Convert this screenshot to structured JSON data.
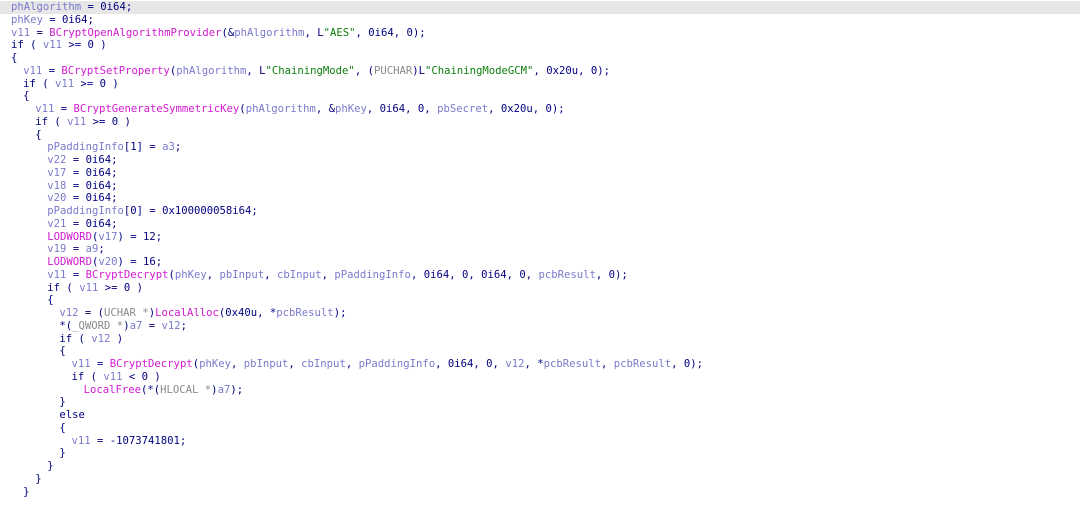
{
  "colors": {
    "highlight": "#e6e6e6",
    "variable": "#1f1fa8",
    "argument": "#7a7acc",
    "function": "#d21bd2",
    "string": "#0e7e0e",
    "type": "#8a8a8a",
    "default": "#000080"
  },
  "lines": [
    {
      "highlight": true,
      "indent": 0,
      "tokens": [
        {
          "t": "phAlgorithm",
          "k": "arg"
        },
        {
          "t": " = 0i64;",
          "k": "punc"
        }
      ]
    },
    {
      "indent": 0,
      "tokens": [
        {
          "t": "phKey",
          "k": "arg"
        },
        {
          "t": " = 0i64;",
          "k": "punc"
        }
      ]
    },
    {
      "indent": 0,
      "tokens": [
        {
          "t": "v11",
          "k": "arg"
        },
        {
          "t": " = ",
          "k": "punc"
        },
        {
          "t": "BCryptOpenAlgorithmProvider",
          "k": "func"
        },
        {
          "t": "(&",
          "k": "punc"
        },
        {
          "t": "phAlgorithm",
          "k": "arg"
        },
        {
          "t": ", L",
          "k": "punc"
        },
        {
          "t": "\"AES\"",
          "k": "str"
        },
        {
          "t": ", 0i64, 0);",
          "k": "punc"
        }
      ]
    },
    {
      "indent": 0,
      "tokens": [
        {
          "t": "if ( ",
          "k": "punc"
        },
        {
          "t": "v11",
          "k": "arg"
        },
        {
          "t": " >= 0 )",
          "k": "punc"
        }
      ]
    },
    {
      "indent": 0,
      "tokens": [
        {
          "t": "{",
          "k": "punc"
        }
      ]
    },
    {
      "indent": 1,
      "tokens": [
        {
          "t": "v11",
          "k": "arg"
        },
        {
          "t": " = ",
          "k": "punc"
        },
        {
          "t": "BCryptSetProperty",
          "k": "func"
        },
        {
          "t": "(",
          "k": "punc"
        },
        {
          "t": "phAlgorithm",
          "k": "arg"
        },
        {
          "t": ", L",
          "k": "punc"
        },
        {
          "t": "\"ChainingMode\"",
          "k": "str"
        },
        {
          "t": ", (",
          "k": "punc"
        },
        {
          "t": "PUCHAR",
          "k": "type"
        },
        {
          "t": ")L",
          "k": "punc"
        },
        {
          "t": "\"ChainingModeGCM\"",
          "k": "str"
        },
        {
          "t": ", 0x20u, 0);",
          "k": "punc"
        }
      ]
    },
    {
      "indent": 1,
      "tokens": [
        {
          "t": "if ( ",
          "k": "punc"
        },
        {
          "t": "v11",
          "k": "arg"
        },
        {
          "t": " >= 0 )",
          "k": "punc"
        }
      ]
    },
    {
      "indent": 1,
      "tokens": [
        {
          "t": "{",
          "k": "punc"
        }
      ]
    },
    {
      "indent": 2,
      "tokens": [
        {
          "t": "v11",
          "k": "arg"
        },
        {
          "t": " = ",
          "k": "punc"
        },
        {
          "t": "BCryptGenerateSymmetricKey",
          "k": "func"
        },
        {
          "t": "(",
          "k": "punc"
        },
        {
          "t": "phAlgorithm",
          "k": "arg"
        },
        {
          "t": ", &",
          "k": "punc"
        },
        {
          "t": "phKey",
          "k": "arg"
        },
        {
          "t": ", 0i64, 0, ",
          "k": "punc"
        },
        {
          "t": "pbSecret",
          "k": "arg"
        },
        {
          "t": ", 0x20u, 0);",
          "k": "punc"
        }
      ]
    },
    {
      "indent": 2,
      "tokens": [
        {
          "t": "if ( ",
          "k": "punc"
        },
        {
          "t": "v11",
          "k": "arg"
        },
        {
          "t": " >= 0 )",
          "k": "punc"
        }
      ]
    },
    {
      "indent": 2,
      "tokens": [
        {
          "t": "{",
          "k": "punc"
        }
      ]
    },
    {
      "indent": 3,
      "tokens": [
        {
          "t": "pPaddingInfo",
          "k": "arg"
        },
        {
          "t": "[1] = ",
          "k": "punc"
        },
        {
          "t": "a3",
          "k": "arg"
        },
        {
          "t": ";",
          "k": "punc"
        }
      ]
    },
    {
      "indent": 3,
      "tokens": [
        {
          "t": "v22",
          "k": "arg"
        },
        {
          "t": " = 0i64;",
          "k": "punc"
        }
      ]
    },
    {
      "indent": 3,
      "tokens": [
        {
          "t": "v17",
          "k": "arg"
        },
        {
          "t": " = 0i64;",
          "k": "punc"
        }
      ]
    },
    {
      "indent": 3,
      "tokens": [
        {
          "t": "v18",
          "k": "arg"
        },
        {
          "t": " = 0i64;",
          "k": "punc"
        }
      ]
    },
    {
      "indent": 3,
      "tokens": [
        {
          "t": "v20",
          "k": "arg"
        },
        {
          "t": " = 0i64;",
          "k": "punc"
        }
      ]
    },
    {
      "indent": 3,
      "tokens": [
        {
          "t": "pPaddingInfo",
          "k": "arg"
        },
        {
          "t": "[0] = 0x100000058i64;",
          "k": "punc"
        }
      ]
    },
    {
      "indent": 3,
      "tokens": [
        {
          "t": "v21",
          "k": "arg"
        },
        {
          "t": " = 0i64;",
          "k": "punc"
        }
      ]
    },
    {
      "indent": 3,
      "tokens": [
        {
          "t": "LODWORD",
          "k": "func"
        },
        {
          "t": "(",
          "k": "punc"
        },
        {
          "t": "v17",
          "k": "arg"
        },
        {
          "t": ") = 12;",
          "k": "punc"
        }
      ]
    },
    {
      "indent": 3,
      "tokens": [
        {
          "t": "v19",
          "k": "arg"
        },
        {
          "t": " = ",
          "k": "punc"
        },
        {
          "t": "a9",
          "k": "arg"
        },
        {
          "t": ";",
          "k": "punc"
        }
      ]
    },
    {
      "indent": 3,
      "tokens": [
        {
          "t": "LODWORD",
          "k": "func"
        },
        {
          "t": "(",
          "k": "punc"
        },
        {
          "t": "v20",
          "k": "arg"
        },
        {
          "t": ") = 16;",
          "k": "punc"
        }
      ]
    },
    {
      "indent": 3,
      "tokens": [
        {
          "t": "v11",
          "k": "arg"
        },
        {
          "t": " = ",
          "k": "punc"
        },
        {
          "t": "BCryptDecrypt",
          "k": "func"
        },
        {
          "t": "(",
          "k": "punc"
        },
        {
          "t": "phKey",
          "k": "arg"
        },
        {
          "t": ", ",
          "k": "punc"
        },
        {
          "t": "pbInput",
          "k": "arg"
        },
        {
          "t": ", ",
          "k": "punc"
        },
        {
          "t": "cbInput",
          "k": "arg"
        },
        {
          "t": ", ",
          "k": "punc"
        },
        {
          "t": "pPaddingInfo",
          "k": "arg"
        },
        {
          "t": ", 0i64, 0, 0i64, 0, ",
          "k": "punc"
        },
        {
          "t": "pcbResult",
          "k": "arg"
        },
        {
          "t": ", 0);",
          "k": "punc"
        }
      ]
    },
    {
      "indent": 3,
      "tokens": [
        {
          "t": "if ( ",
          "k": "punc"
        },
        {
          "t": "v11",
          "k": "arg"
        },
        {
          "t": " >= 0 )",
          "k": "punc"
        }
      ]
    },
    {
      "indent": 3,
      "tokens": [
        {
          "t": "{",
          "k": "punc"
        }
      ]
    },
    {
      "indent": 4,
      "tokens": [
        {
          "t": "v12",
          "k": "arg"
        },
        {
          "t": " = (",
          "k": "punc"
        },
        {
          "t": "UCHAR *",
          "k": "type"
        },
        {
          "t": ")",
          "k": "punc"
        },
        {
          "t": "LocalAlloc",
          "k": "func"
        },
        {
          "t": "(0x40u, *",
          "k": "punc"
        },
        {
          "t": "pcbResult",
          "k": "arg"
        },
        {
          "t": ");",
          "k": "punc"
        }
      ]
    },
    {
      "indent": 4,
      "tokens": [
        {
          "t": "*(",
          "k": "punc"
        },
        {
          "t": "_QWORD *",
          "k": "type"
        },
        {
          "t": ")",
          "k": "punc"
        },
        {
          "t": "a7",
          "k": "arg"
        },
        {
          "t": " = ",
          "k": "punc"
        },
        {
          "t": "v12",
          "k": "arg"
        },
        {
          "t": ";",
          "k": "punc"
        }
      ]
    },
    {
      "indent": 4,
      "tokens": [
        {
          "t": "if ( ",
          "k": "punc"
        },
        {
          "t": "v12",
          "k": "arg"
        },
        {
          "t": " )",
          "k": "punc"
        }
      ]
    },
    {
      "indent": 4,
      "tokens": [
        {
          "t": "{",
          "k": "punc"
        }
      ]
    },
    {
      "indent": 5,
      "tokens": [
        {
          "t": "v11",
          "k": "arg"
        },
        {
          "t": " = ",
          "k": "punc"
        },
        {
          "t": "BCryptDecrypt",
          "k": "func"
        },
        {
          "t": "(",
          "k": "punc"
        },
        {
          "t": "phKey",
          "k": "arg"
        },
        {
          "t": ", ",
          "k": "punc"
        },
        {
          "t": "pbInput",
          "k": "arg"
        },
        {
          "t": ", ",
          "k": "punc"
        },
        {
          "t": "cbInput",
          "k": "arg"
        },
        {
          "t": ", ",
          "k": "punc"
        },
        {
          "t": "pPaddingInfo",
          "k": "arg"
        },
        {
          "t": ", 0i64, 0, ",
          "k": "punc"
        },
        {
          "t": "v12",
          "k": "arg"
        },
        {
          "t": ", *",
          "k": "punc"
        },
        {
          "t": "pcbResult",
          "k": "arg"
        },
        {
          "t": ", ",
          "k": "punc"
        },
        {
          "t": "pcbResult",
          "k": "arg"
        },
        {
          "t": ", 0);",
          "k": "punc"
        }
      ]
    },
    {
      "indent": 5,
      "tokens": [
        {
          "t": "if ( ",
          "k": "punc"
        },
        {
          "t": "v11",
          "k": "arg"
        },
        {
          "t": " < 0 )",
          "k": "punc"
        }
      ]
    },
    {
      "indent": 6,
      "tokens": [
        {
          "t": "LocalFree",
          "k": "func"
        },
        {
          "t": "(*(",
          "k": "punc"
        },
        {
          "t": "HLOCAL *",
          "k": "type"
        },
        {
          "t": ")",
          "k": "punc"
        },
        {
          "t": "a7",
          "k": "arg"
        },
        {
          "t": ");",
          "k": "punc"
        }
      ]
    },
    {
      "indent": 4,
      "tokens": [
        {
          "t": "}",
          "k": "punc"
        }
      ]
    },
    {
      "indent": 4,
      "tokens": [
        {
          "t": "else",
          "k": "punc"
        }
      ]
    },
    {
      "indent": 4,
      "tokens": [
        {
          "t": "{",
          "k": "punc"
        }
      ]
    },
    {
      "indent": 5,
      "tokens": [
        {
          "t": "v11",
          "k": "arg"
        },
        {
          "t": " = -1073741801;",
          "k": "punc"
        }
      ]
    },
    {
      "indent": 4,
      "tokens": [
        {
          "t": "}",
          "k": "punc"
        }
      ]
    },
    {
      "indent": 3,
      "tokens": [
        {
          "t": "}",
          "k": "punc"
        }
      ]
    },
    {
      "indent": 2,
      "tokens": [
        {
          "t": "}",
          "k": "punc"
        }
      ]
    },
    {
      "indent": 1,
      "tokens": [
        {
          "t": "}",
          "k": "punc"
        }
      ]
    }
  ]
}
